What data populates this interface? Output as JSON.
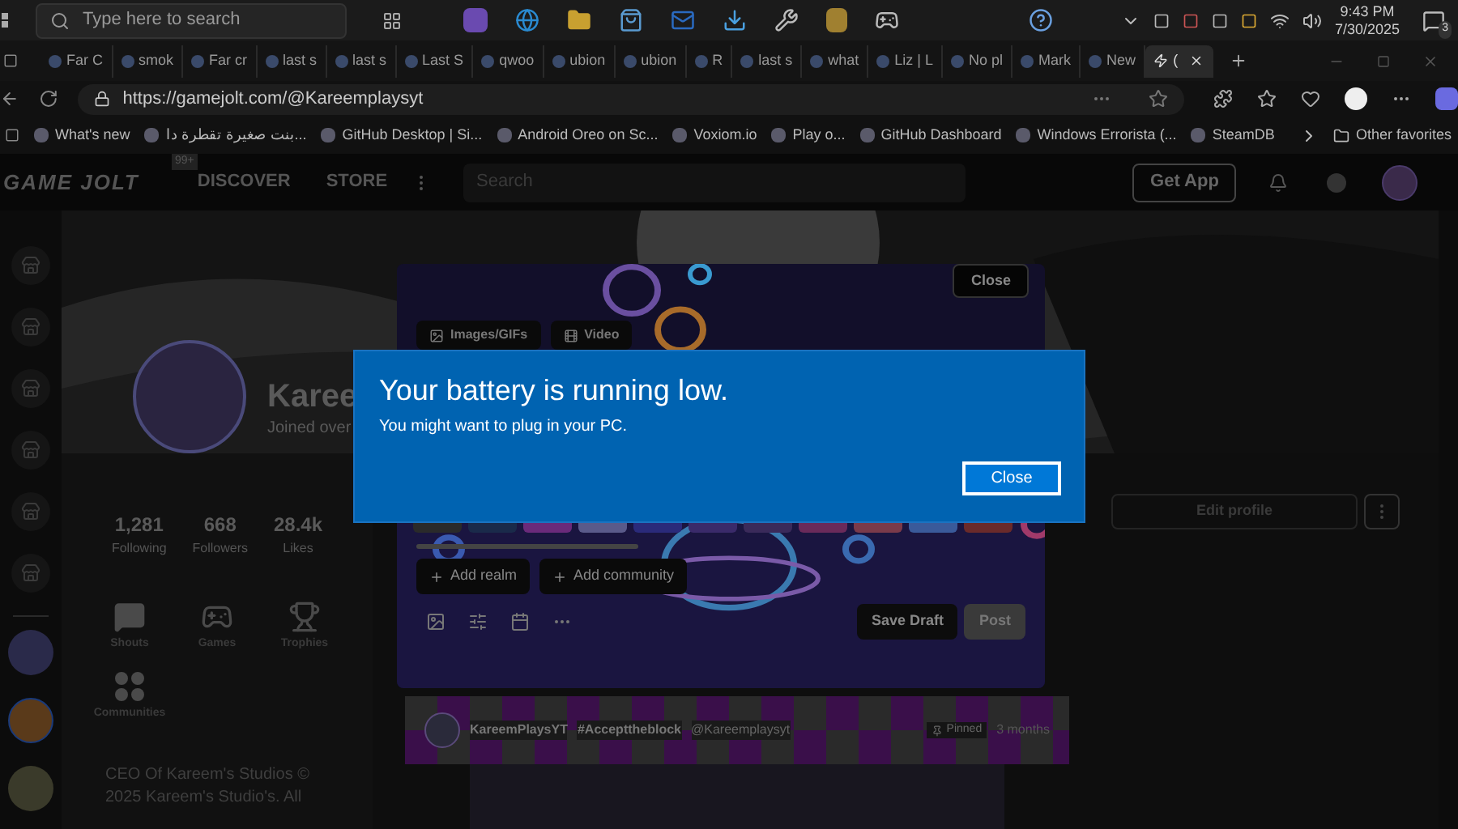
{
  "taskbar": {
    "search_placeholder": "Type here to search",
    "time": "9:43 PM",
    "date": "7/30/2025",
    "notification_count": "3"
  },
  "browser_tabs": [
    {
      "label": "Far C",
      "selected": false
    },
    {
      "label": "smok",
      "selected": false
    },
    {
      "label": "Far cr",
      "selected": false
    },
    {
      "label": "last s",
      "selected": false
    },
    {
      "label": "last s",
      "selected": false
    },
    {
      "label": "Last S",
      "selected": false
    },
    {
      "label": "qwoo",
      "selected": false
    },
    {
      "label": "ubion",
      "selected": false
    },
    {
      "label": "ubion",
      "selected": false
    },
    {
      "label": "R",
      "selected": false
    },
    {
      "label": "last s",
      "selected": false
    },
    {
      "label": "what",
      "selected": false
    },
    {
      "label": "Liz | L",
      "selected": false
    },
    {
      "label": "No pl",
      "selected": false
    },
    {
      "label": "Mark",
      "selected": false
    },
    {
      "label": "New",
      "selected": false
    },
    {
      "label": "(",
      "selected": true
    }
  ],
  "address_bar": {
    "url": "https://gamejolt.com/@Kareemplaysyt"
  },
  "favorites": [
    {
      "label": "What's new"
    },
    {
      "label": "بنت صغيرة تقطرة دا..."
    },
    {
      "label": "GitHub Desktop | Si..."
    },
    {
      "label": "Android Oreo on Sc..."
    },
    {
      "label": "Voxiom.io"
    },
    {
      "label": "Play o..."
    },
    {
      "label": "GitHub Dashboard"
    },
    {
      "label": "Windows Errorista (..."
    },
    {
      "label": "SteamDB"
    }
  ],
  "other_favorites": "Other favorites",
  "site_nav": {
    "logo": "GAME JOLT",
    "notification_badge": "99+",
    "links": [
      "DISCOVER",
      "STORE"
    ],
    "search_placeholder": "Search",
    "get_app": "Get App"
  },
  "profile": {
    "name": "Karee",
    "joined": "Joined over",
    "stats": [
      {
        "value": "1,281",
        "label": "Following"
      },
      {
        "value": "668",
        "label": "Followers"
      },
      {
        "value": "28.4k",
        "label": "Likes"
      }
    ],
    "sections": [
      {
        "label": "Shouts",
        "kind": "chat"
      },
      {
        "label": "Games",
        "kind": "gamepad"
      },
      {
        "label": "Trophies",
        "kind": "trophy"
      },
      {
        "label": "Communities",
        "kind": "grid"
      }
    ],
    "bio": "CEO Of Kareem's Studios © 2025 Kareem's Studio's. All"
  },
  "edit_profile": "Edit profile",
  "composer": {
    "close": "Close",
    "media_buttons": [
      "Images/GIFs",
      "Video"
    ],
    "add_buttons": [
      "Add realm",
      "Add community"
    ],
    "save_draft": "Save Draft",
    "post": "Post"
  },
  "pinned_post": {
    "author": "KareemPlaysYT",
    "tag": "#Accepttheblock",
    "handle": "@Kareemplaysyt",
    "badge": "Pinned",
    "time": "3 months"
  },
  "battery_toast": {
    "title": "Your battery is running low.",
    "message": "You might want to plug in your PC.",
    "button": "Close"
  }
}
